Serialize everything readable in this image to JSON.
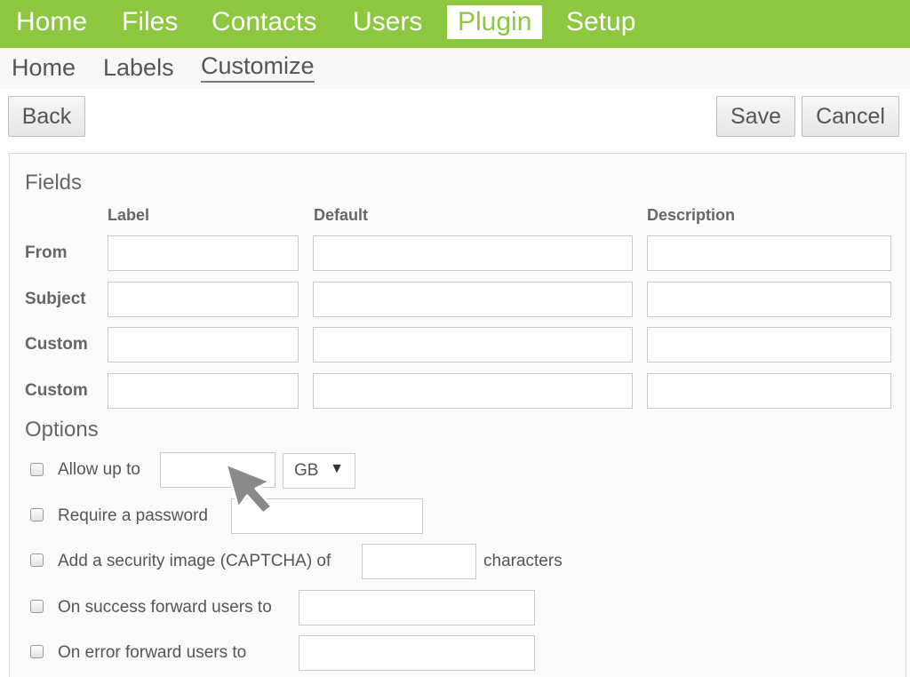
{
  "topnav": {
    "items": [
      "Home",
      "Files",
      "Contacts",
      "Users",
      "Plugin",
      "Setup"
    ],
    "active": "Plugin",
    "accent_color": "#8dc63f"
  },
  "subnav": {
    "items": [
      "Home",
      "Labels",
      "Customize"
    ],
    "active": "Customize"
  },
  "toolbar": {
    "back_label": "Back",
    "save_label": "Save",
    "cancel_label": "Cancel"
  },
  "fields": {
    "title": "Fields",
    "columns": [
      "Label",
      "Default",
      "Description"
    ],
    "rows": [
      {
        "name": "From",
        "label": "",
        "default": "",
        "description": ""
      },
      {
        "name": "Subject",
        "label": "",
        "default": "",
        "description": ""
      },
      {
        "name": "Custom",
        "label": "",
        "default": "",
        "description": ""
      },
      {
        "name": "Custom",
        "label": "",
        "default": "",
        "description": ""
      }
    ]
  },
  "options": {
    "title": "Options",
    "allow": {
      "label": "Allow up to",
      "value": "",
      "unit": "GB",
      "checked": false
    },
    "password": {
      "label": "Require a password",
      "value": "",
      "checked": false
    },
    "captcha": {
      "label": "Add a security image (CAPTCHA) of",
      "value": "",
      "suffix": "characters",
      "checked": false
    },
    "success": {
      "label": "On success forward users to",
      "value": "",
      "checked": false
    },
    "error": {
      "label": "On error forward users to",
      "value": "",
      "checked": false
    }
  },
  "icons": {
    "cursor": "mouse-pointer-icon",
    "dropdown": "triangle-down-icon"
  }
}
